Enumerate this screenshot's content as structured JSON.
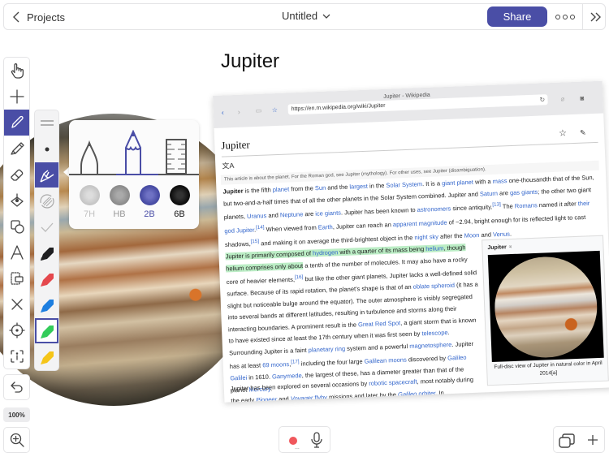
{
  "topbar": {
    "back_label": "Projects",
    "doc_title": "Untitled",
    "share_label": "Share"
  },
  "canvas": {
    "page_title": "Jupiter"
  },
  "toolbar": {
    "tools": [
      {
        "name": "hand",
        "active": false
      },
      {
        "name": "add",
        "active": false
      },
      {
        "name": "pencil",
        "active": true
      },
      {
        "name": "highlighter",
        "active": false
      },
      {
        "name": "eraser",
        "active": false
      },
      {
        "name": "fill",
        "active": false
      },
      {
        "name": "shapes",
        "active": false
      },
      {
        "name": "text",
        "active": false
      },
      {
        "name": "selection",
        "active": false
      },
      {
        "name": "delete",
        "active": false
      },
      {
        "name": "target",
        "active": false
      },
      {
        "name": "info",
        "active": false
      }
    ],
    "zoom_level": "100%"
  },
  "subtoolbar": {
    "items": [
      "stroke-width",
      "dot",
      "pencil-style",
      "texture",
      "check"
    ],
    "colors": [
      "#1f1f21",
      "#e5484d",
      "#1e7fe0",
      "#33cc5a",
      "#f5c518"
    ],
    "selected_color": "#33cc5a"
  },
  "pencil_popup": {
    "pens": [
      "fineliner",
      "pencil",
      "ruler"
    ],
    "selected_pen": "pencil",
    "grades": [
      {
        "label": "7H",
        "color": "#c8c8c8"
      },
      {
        "label": "HB",
        "color": "#8f8f8f"
      },
      {
        "label": "2B",
        "color": "#4a4ea6"
      },
      {
        "label": "6B",
        "color": "#111111"
      }
    ],
    "selected_grade": "2B"
  },
  "wiki": {
    "tab_title": "Jupiter - Wikipedia",
    "url": "https://en.m.wikipedia.org/wiki/Jupiter",
    "heading": "Jupiter",
    "hatnote": "This article is about the planet. For the Roman god, see Jupiter (mythology). For other uses, see Jupiter (disambiguation).",
    "infobox_title": "Jupiter ♃",
    "infobox_caption": "Full-disc view of Jupiter in natural color in April 2014[a]"
  },
  "accent_color": "#4a4ea6"
}
